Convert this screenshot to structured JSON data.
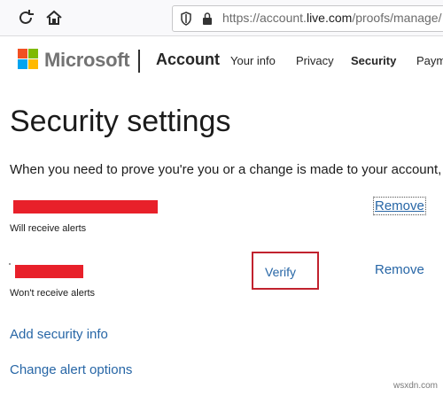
{
  "browser": {
    "url_prefix": "https://account.",
    "url_host": "live.com",
    "url_path": "/proofs/manage/"
  },
  "header": {
    "brand": "Microsoft",
    "section": "Account",
    "nav": [
      "Your info",
      "Privacy",
      "Security",
      "Paym"
    ]
  },
  "page": {
    "title": "Security settings",
    "intro": "When you need to prove you're you or a change is made to your account, w"
  },
  "proofs": [
    {
      "note": "Will receive alerts",
      "remove_label": "Remove"
    },
    {
      "note": "Won't receive alerts",
      "verify_label": "Verify",
      "remove_label": "Remove"
    }
  ],
  "links": {
    "add": "Add security info",
    "change": "Change alert options"
  },
  "watermark": "wsxdn.com",
  "colors": {
    "link": "#2766a6",
    "redaction": "#e8202a",
    "highlight_box": "#c1222e"
  }
}
